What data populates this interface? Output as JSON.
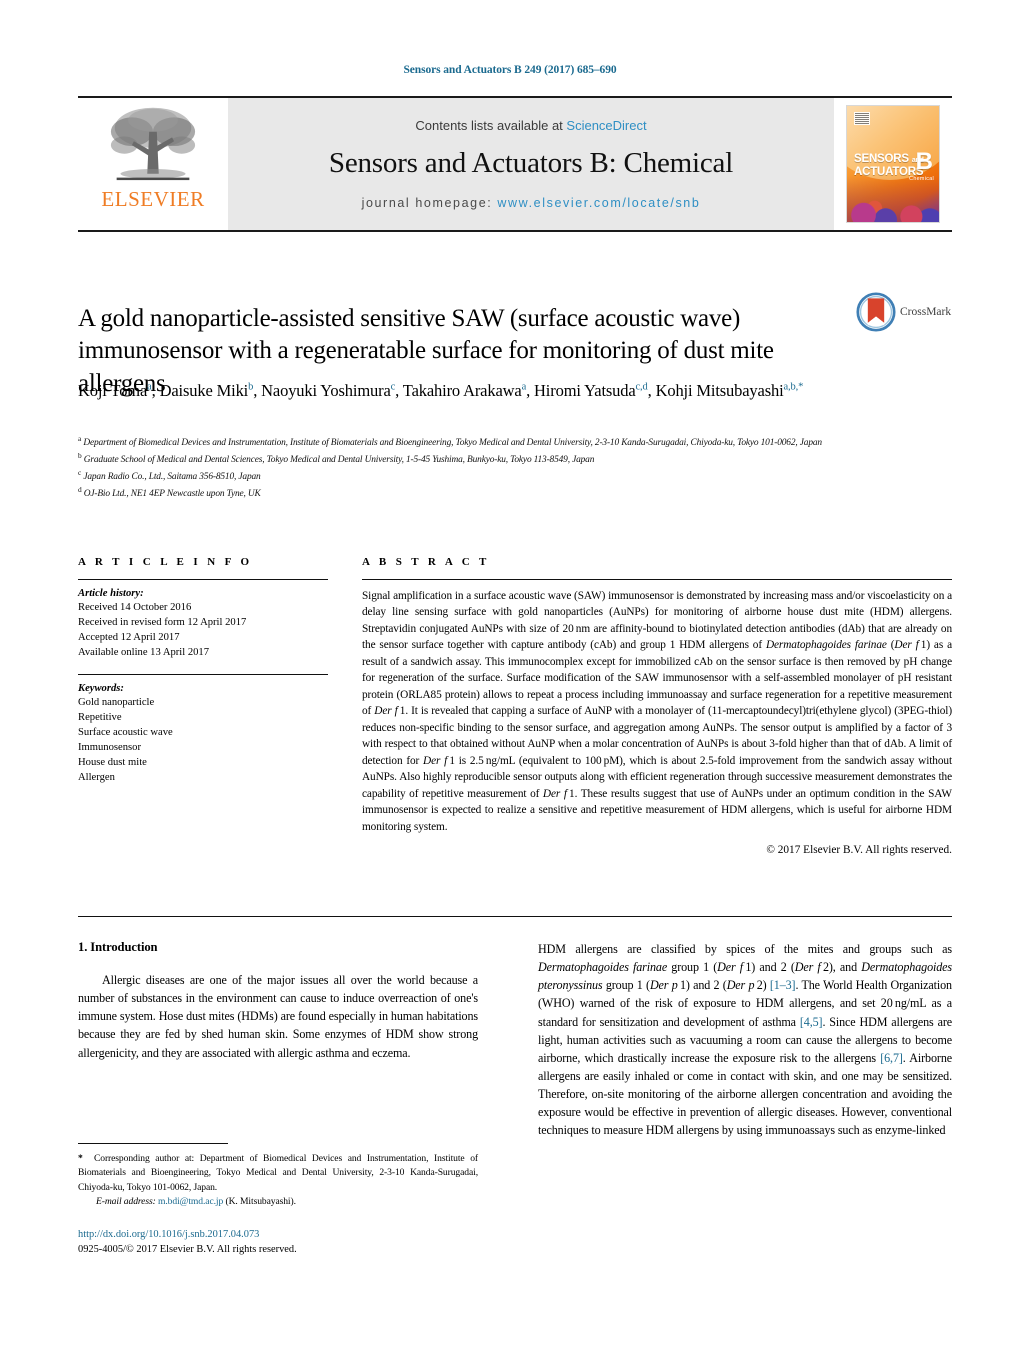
{
  "header": {
    "running_head": "Sensors and Actuators B 249 (2017) 685–690",
    "contents_prefix": "Contents lists available at ",
    "sciencedirect": "ScienceDirect",
    "journal_name": "Sensors and Actuators B: Chemical",
    "homepage_prefix": "journal homepage: ",
    "homepage_url": "www.elsevier.com/locate/snb",
    "publisher": "ELSEVIER",
    "cover": {
      "line1": "SENSORS",
      "line1_small": "and",
      "line2": "ACTUATORS",
      "volume_letter": "B",
      "volume_sub": "Chemical"
    }
  },
  "article": {
    "title": "A gold nanoparticle-assisted sensitive SAW (surface acoustic wave) immunosensor with a regeneratable surface for monitoring of dust mite allergens",
    "crossmark_label": "CrossMark",
    "authors_html": "Koji Toma<sup>a</sup>, Daisuke Miki<sup>b</sup>, Naoyuki Yoshimura<sup>c</sup>, Takahiro Arakawa<sup>a</sup>, Hiromi Yatsuda<sup>c,d</sup>, Kohji Mitsubayashi<sup>a,b,<span class=\"star\">*</span></sup>",
    "affiliations": [
      {
        "mark": "a",
        "text": "Department of Biomedical Devices and Instrumentation, Institute of Biomaterials and Bioengineering, Tokyo Medical and Dental University, 2-3-10 Kanda-Surugadai, Chiyoda-ku, Tokyo 101-0062, Japan"
      },
      {
        "mark": "b",
        "text": "Graduate School of Medical and Dental Sciences, Tokyo Medical and Dental University, 1-5-45 Yushima, Bunkyo-ku, Tokyo 113-8549, Japan"
      },
      {
        "mark": "c",
        "text": "Japan Radio Co., Ltd., Saitama 356-8510, Japan"
      },
      {
        "mark": "d",
        "text": "OJ-Bio Ltd., NE1 4EP Newcastle upon Tyne, UK"
      }
    ]
  },
  "article_info": {
    "label": "A R T I C L E   I N F O",
    "history_label": "Article history:",
    "history": [
      "Received 14 October 2016",
      "Received in revised form 12 April 2017",
      "Accepted 12 April 2017",
      "Available online 13 April 2017"
    ],
    "keywords_label": "Keywords:",
    "keywords": [
      "Gold nanoparticle",
      "Repetitive",
      "Surface acoustic wave",
      "Immunosensor",
      "House dust mite",
      "Allergen"
    ]
  },
  "abstract": {
    "label": "A B S T R A C T",
    "body_html": "Signal amplification in a surface acoustic wave (SAW) immunosensor is demonstrated by increasing mass and/or viscoelasticity on a delay line sensing surface with gold nanoparticles (AuNPs) for monitoring of airborne house dust mite (HDM) allergens. Streptavidin conjugated AuNPs with size of 20&#8239;nm are affinity-bound to biotinylated detection antibodies (dAb) that are already on the sensor surface together with capture antibody (cAb) and group 1 HDM allergens of <i>Dermatophagoides farinae</i> (<i>Der f</i>&#8239;1) as a result of a sandwich assay. This immunocomplex except for immobilized cAb on the sensor surface is then removed by pH change for regeneration of the surface. Surface modification of the SAW immunosensor with a self-assembled monolayer of pH resistant protein (ORLA85 protein) allows to repeat a process including immunoassay and surface regeneration for a repetitive measurement of <i>Der f</i>&#8239;1. It is revealed that capping a surface of AuNP with a monolayer of (11-mercaptoundecyl)tri(ethylene glycol) (3PEG-thiol) reduces non-specific binding to the sensor surface, and aggregation among AuNPs. The sensor output is amplified by a factor of 3 with respect to that obtained without AuNP when a molar concentration of AuNPs is about 3-fold higher than that of dAb. A limit of detection for <i>Der f</i>&#8239;1 is 2.5&#8239;ng/mL (equivalent to 100&#8239;pM), which is about 2.5-fold improvement from the sandwich assay without AuNPs. Also highly reproducible sensor outputs along with efficient regeneration through successive measurement demonstrates the capability of repetitive measurement of <i>Der f</i>&#8239;1. These results suggest that use of AuNPs under an optimum condition in the SAW immunosensor is expected to realize a sensitive and repetitive measurement of HDM allergens, which is useful for airborne HDM monitoring system.",
    "copyright": "© 2017 Elsevier B.V. All rights reserved."
  },
  "introduction": {
    "heading": "1.  Introduction",
    "left_paragraph_html": "Allergic diseases are one of the major issues all over the world because a number of substances in the environment can cause to induce overreaction of one's immune system. Hose dust mites (HDMs) are found especially in human habitations because they are fed by shed human skin. Some enzymes of HDM show strong allergenicity, and they are associated with allergic asthma and eczema.",
    "right_paragraph_html": "HDM allergens are classified by spices of the mites and groups such as <i>Dermatophagoides farinae</i> group 1 (<i>Der f</i>&#8239;1) and 2 (<i>Der f</i>&#8239;2), and <i>Dermatophagoides pteronyssinus</i> group 1 (<i>Der p</i>&#8239;1) and 2 (<i>Der p</i>&#8239;2) <span class=\"ref\">[1–3]</span>. The World Health Organization (WHO) warned of the risk of exposure to HDM allergens, and set 20&#8239;ng/mL as a standard for sensitization and development of asthma <span class=\"ref\">[4,5]</span>. Since HDM allergens are light, human activities such as vacuuming a room can cause the allergens to become airborne, which drastically increase the exposure risk to the allergens <span class=\"ref\">[6,7]</span>. Airborne allergens are easily inhaled or come in contact with skin, and one may be sensitized. Therefore, on-site monitoring of the airborne allergen concentration and avoiding the exposure would be effective in prevention of allergic diseases. However, conventional techniques to measure HDM allergens by using immunoassays such as enzyme-linked"
  },
  "footer": {
    "corresponding_html": "<b>*</b>&nbsp; Corresponding author at: Department of Biomedical Devices and Instrumentation, Institute of Biomaterials and Bioengineering, Tokyo Medical and Dental University, 2-3-10 Kanda-Surugadai, Chiyoda-ku, Tokyo 101-0062, Japan.",
    "email_label": "E-mail address:",
    "email": "m.bdi@tmd.ac.jp",
    "email_owner": "(K. Mitsubayashi).",
    "doi_url": "http://dx.doi.org/10.1016/j.snb.2017.04.073",
    "issn_line": "0925-4005/© 2017 Elsevier B.V. All rights reserved."
  },
  "colors": {
    "link": "#1b6a8f",
    "sciencedirect": "#2f8fc4",
    "elsevier_orange": "#ef7c24",
    "band_gray": "#e8e8e8"
  }
}
